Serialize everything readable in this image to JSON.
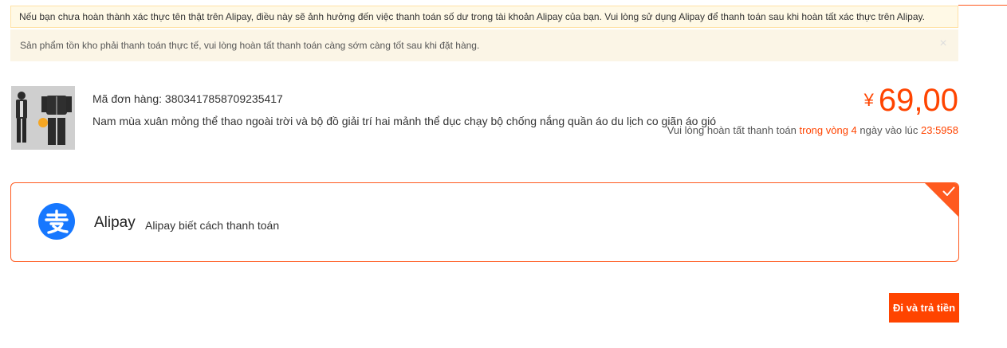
{
  "notices": {
    "verification": "Nếu bạn chưa hoàn thành xác thực tên thật trên Alipay, điều này sẽ ảnh hưởng đến việc thanh toán số dư trong tài khoản Alipay của bạn. Vui lòng sử dụng Alipay để thanh toán sau khi hoàn tất xác thực trên Alipay.",
    "stock": "Sản phẩm tồn kho phải thanh toán thực tế, vui lòng hoàn tất thanh toán càng sớm càng tốt sau khi đặt hàng.",
    "close_symbol": "×"
  },
  "order": {
    "number_label": "Mã đơn hàng: 3803417858709235417",
    "product_name": "Nam mùa xuân mỏng thể thao ngoài trời và bộ đồ giải trí hai mảnh thể dục chạy bộ chống nắng quần áo du lịch co giãn áo gió",
    "thumbnail_icon": "product-thumbnail",
    "currency": "¥",
    "price": "69,00",
    "deadline": {
      "prefix": "Vui lòng hoàn tất thanh toán ",
      "highlight": "trong vòng 4",
      "middle": " ngày vào lúc ",
      "time": "23:5958"
    }
  },
  "payment": {
    "method_name": "Alipay",
    "method_desc": "Alipay biết cách thanh toán",
    "logo_icon": "alipay-logo",
    "selected": true,
    "selected_icon": "check-icon",
    "brand_color": "#1677ff",
    "accent_color": "#ff5a1f"
  },
  "actions": {
    "pay_label": "Đi và trả tiền"
  }
}
